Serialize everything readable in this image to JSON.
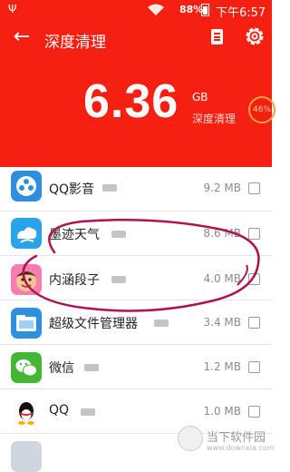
{
  "status_bar": {
    "battery_percent": "88%",
    "time": "下午6:57"
  },
  "header": {
    "title": "深度清理",
    "total_size": "6.36",
    "unit": "GB",
    "subtitle": "深度清理",
    "progress": "46%"
  },
  "apps": [
    {
      "name": "QQ影音",
      "size": "9.2 MB",
      "checked": false
    },
    {
      "name": "墨迹天气",
      "size": "8.6 MB",
      "checked": false
    },
    {
      "name": "内涵段子",
      "size": "4.0 MB",
      "checked": false
    },
    {
      "name": "超级文件管理器",
      "size": "3.4 MB",
      "checked": false
    },
    {
      "name": "微信",
      "size": "1.2 MB",
      "checked": false
    },
    {
      "name": "QQ",
      "size": "1.0 MB",
      "checked": false
    }
  ],
  "watermark": {
    "text": "当下软件园",
    "url": "www.downxia.com"
  },
  "colors": {
    "header_bg": "#f51f12",
    "annotation_stroke": "#b0124e"
  }
}
